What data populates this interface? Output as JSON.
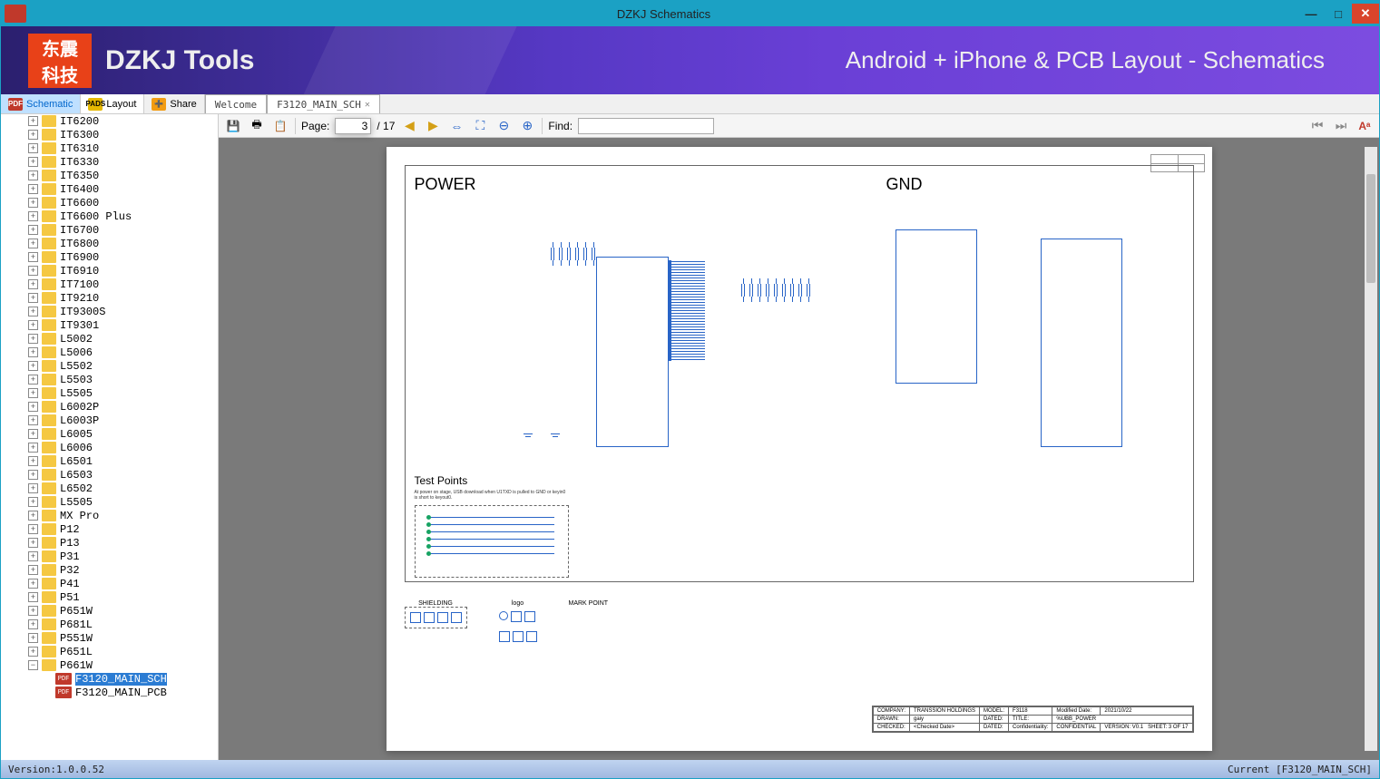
{
  "window": {
    "title": "DZKJ Schematics"
  },
  "banner": {
    "logo_cn_top": "东震",
    "logo_cn_bot": "科技",
    "logo_text": "DZKJ Tools",
    "tagline": "Android + iPhone & PCB Layout - Schematics"
  },
  "tabs": {
    "schematic": "Schematic",
    "layout": "Layout",
    "share": "Share",
    "welcome": "Welcome",
    "doc": "F3120_MAIN_SCH"
  },
  "toolbar": {
    "page_label": "Page:",
    "page_current": "3",
    "page_total": "/ 17",
    "find_label": "Find:",
    "find_value": ""
  },
  "tree": [
    "IT6200",
    "IT6300",
    "IT6310",
    "IT6330",
    "IT6350",
    "IT6400",
    "IT6600",
    "IT6600 Plus",
    "IT6700",
    "IT6800",
    "IT6900",
    "IT6910",
    "IT7100",
    "IT9210",
    "IT9300S",
    "IT9301",
    "L5002",
    "L5006",
    "L5502",
    "L5503",
    "L5505",
    "L6002P",
    "L6003P",
    "L6005",
    "L6006",
    "L6501",
    "L6503",
    "L6502",
    "L5505",
    "MX Pro",
    "P12",
    "P13",
    "P31",
    "P32",
    "P41",
    "P51",
    "P651W",
    "P681L",
    "P551W",
    "P651L"
  ],
  "tree_open": "P661W",
  "tree_children": [
    "F3120_MAIN_SCH",
    "F3120_MAIN_PCB"
  ],
  "schematic": {
    "section1_title": "POWER",
    "section2_title": "GND",
    "testpoints_title": "Test Points",
    "testpoints_sub": "At power on stage, USB download when U1TXD is pulled to GND or keyin0 is short to keyout0.",
    "shielding": "SHIELDING",
    "logo": "logo",
    "markpoint": "MARK POINT"
  },
  "titleblock": {
    "company_l": "COMPANY:",
    "company": "TRANSSION HOLDINGS",
    "model_l": "MODEL:",
    "model": "F3118",
    "modified_l": "Modified Date:",
    "modified": "2021/10/22",
    "drawn_l": "DRAWN:",
    "drawn": "gaiy",
    "date_l": "DATED:",
    "title_l": "TITLE:",
    "title": "%UBB_POWER",
    "checked_l": "CHECKED:",
    "checked": "<Checked Date>",
    "conf_l": "Confidentiality:",
    "conf": "CONFIDENTIAL",
    "ver_l": "VERSION:",
    "ver": "V0.1",
    "sheet_l": "SHEET:",
    "sheet": "3 OF 17"
  },
  "status": {
    "version": "Version:1.0.0.52",
    "current": "Current [F3120_MAIN_SCH]"
  }
}
